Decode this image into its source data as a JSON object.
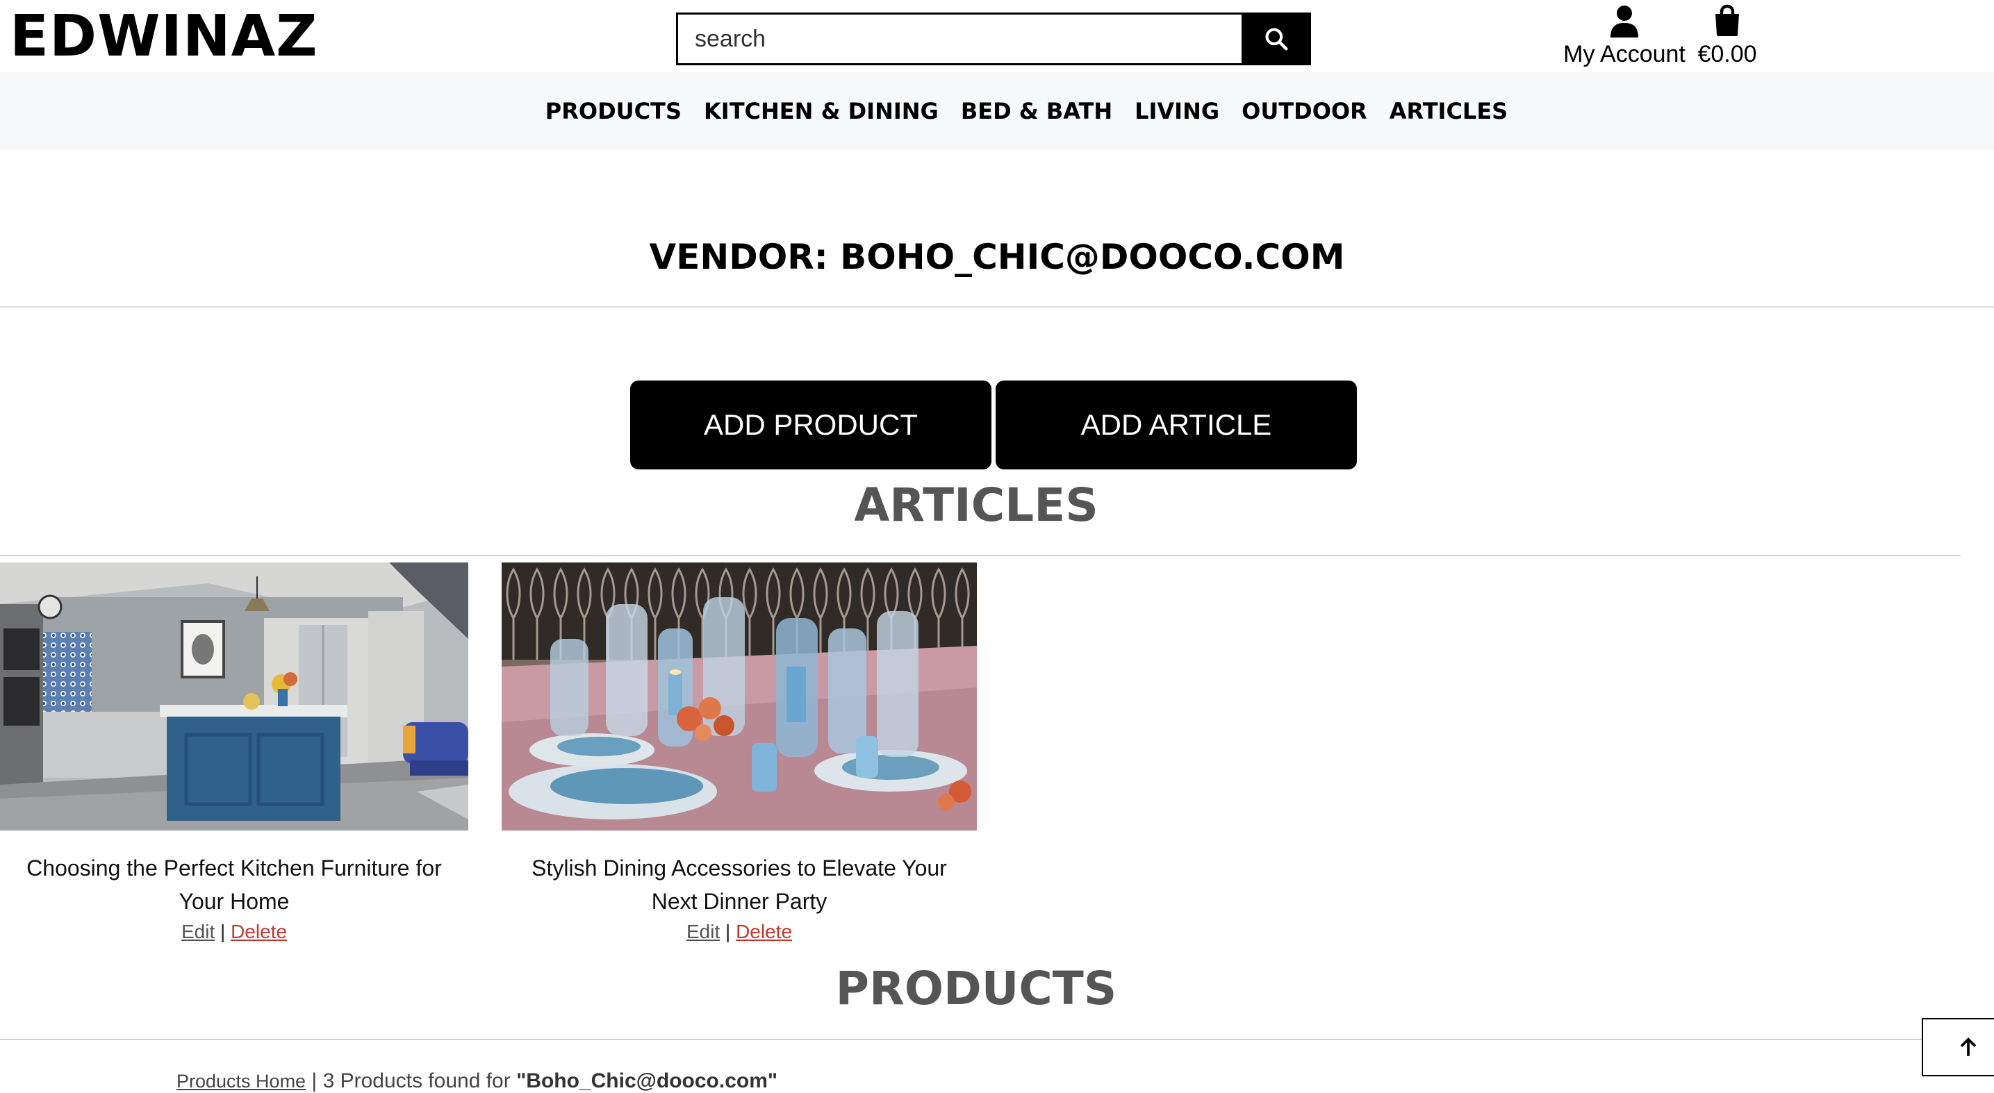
{
  "header": {
    "brand": "EDWINAZ",
    "search_placeholder": "search",
    "search_icon": "search-icon",
    "account_label": "My Account",
    "account_icon": "user-icon",
    "bag_label": "€0.00",
    "bag_icon": "shopping-bag-icon"
  },
  "nav": {
    "items": [
      "PRODUCTS",
      "KITCHEN & DINING",
      "BED & BATH",
      "LIVING",
      "OUTDOOR",
      "ARTICLES"
    ]
  },
  "vendor": {
    "title": "VENDOR: BOHO_CHIC@DOOCO.COM"
  },
  "actions": {
    "add_product": "ADD PRODUCT",
    "add_article": "ADD ARTICLE"
  },
  "articles": {
    "heading": "ARTICLES",
    "items": [
      {
        "title_line1": "Choosing the Perfect Kitchen Furniture for",
        "title_line2": "Your Home",
        "edit": "Edit",
        "separator": "|",
        "delete": "Delete"
      },
      {
        "title_line1": "Stylish Dining Accessories to Elevate Your",
        "title_line2": "Next Dinner Party",
        "edit": "Edit",
        "separator": "|",
        "delete": "Delete"
      }
    ]
  },
  "products": {
    "heading": "PRODUCTS",
    "breadcrumb": "Products Home",
    "separator": "|",
    "count_text": "3 Products found for",
    "query": "\"Boho_Chic@dooco.com\""
  },
  "back_to_top_icon": "arrow-up-icon",
  "colors": {
    "accent": "#000000",
    "delete_link": "#c0392b",
    "nav_bg": "#f7f8f9",
    "heading_gray": "#555555"
  }
}
